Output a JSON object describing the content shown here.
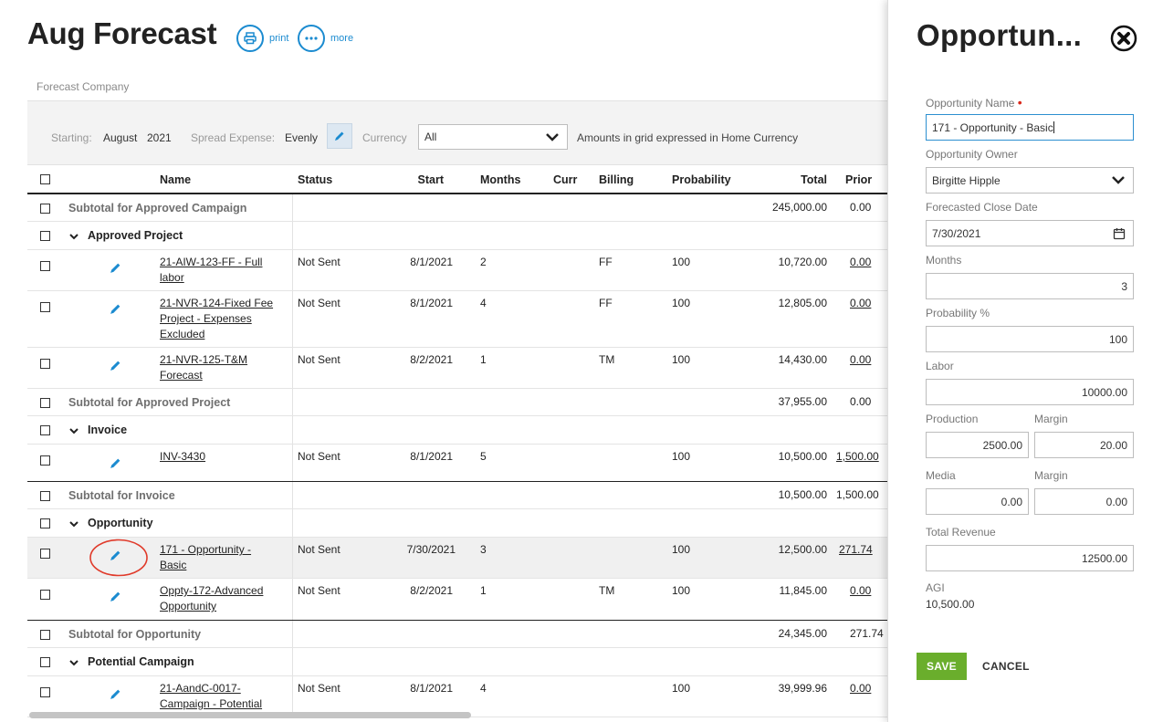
{
  "page": {
    "title": "Aug Forecast",
    "print_label": "print",
    "more_label": "more",
    "company_label": "Forecast Company"
  },
  "filters": {
    "starting_label": "Starting:",
    "starting_month": "August",
    "starting_year": "2021",
    "spread_label": "Spread Expense:",
    "spread_value": "Evenly",
    "currency_label": "Currency",
    "currency_value": "All",
    "note": "Amounts in grid expressed in Home Currency"
  },
  "grid": {
    "columns": {
      "name": "Name",
      "status": "Status",
      "start": "Start",
      "months": "Months",
      "curr": "Curr",
      "billing": "Billing",
      "probability": "Probability",
      "total": "Total",
      "prior": "Prior"
    },
    "rows": {
      "sub_approved_campaign": {
        "label": "Subtotal for Approved Campaign",
        "total": "245,000.00",
        "prior": "0.00"
      },
      "grp_approved_project": {
        "label": "Approved Project"
      },
      "r1": {
        "name": "21-AIW-123-FF - Full labor",
        "status": "Not Sent",
        "start": "8/1/2021",
        "months": "2",
        "billing": "FF",
        "probability": "100",
        "total": "10,720.00",
        "prior": "0.00"
      },
      "r2": {
        "name": "21-NVR-124-Fixed Fee Project - Expenses Excluded",
        "status": "Not Sent",
        "start": "8/1/2021",
        "months": "4",
        "billing": "FF",
        "probability": "100",
        "total": "12,805.00",
        "prior": "0.00"
      },
      "r3": {
        "name": "21-NVR-125-T&M Forecast",
        "status": "Not Sent",
        "start": "8/2/2021",
        "months": "1",
        "billing": "TM",
        "probability": "100",
        "total": "14,430.00",
        "prior": "0.00"
      },
      "sub_approved_project": {
        "label": "Subtotal for Approved Project",
        "total": "37,955.00",
        "prior": "0.00"
      },
      "grp_invoice": {
        "label": "Invoice"
      },
      "r4": {
        "name": "INV-3430",
        "status": "Not Sent",
        "start": "8/1/2021",
        "months": "5",
        "billing": "",
        "probability": "100",
        "total": "10,500.00",
        "prior": "1,500.00"
      },
      "sub_invoice": {
        "label": "Subtotal for Invoice",
        "total": "10,500.00",
        "prior": "1,500.00"
      },
      "grp_opportunity": {
        "label": "Opportunity"
      },
      "r5": {
        "name": "171 - Opportunity - Basic",
        "status": "Not Sent",
        "start": "7/30/2021",
        "months": "3",
        "billing": "",
        "probability": "100",
        "total": "12,500.00",
        "prior": "271.74"
      },
      "r6": {
        "name": "Oppty-172-Advanced Opportunity",
        "status": "Not Sent",
        "start": "8/2/2021",
        "months": "1",
        "billing": "TM",
        "probability": "100",
        "total": "11,845.00",
        "prior": "0.00"
      },
      "sub_opportunity": {
        "label": "Subtotal for Opportunity",
        "total": "24,345.00",
        "prior": "271.74"
      },
      "grp_potential_campaign": {
        "label": "Potential Campaign"
      },
      "r7": {
        "name": "21-AandC-0017-Campaign - Potential",
        "status": "Not Sent",
        "start": "8/1/2021",
        "months": "4",
        "billing": "",
        "probability": "100",
        "total": "39,999.96",
        "prior": "0.00"
      }
    }
  },
  "panel": {
    "title": "Opportun...",
    "opp_name_label": "Opportunity Name",
    "opp_name_value": "171 - Opportunity - Basic",
    "owner_label": "Opportunity Owner",
    "owner_value": "Birgitte Hipple",
    "close_date_label": "Forecasted Close Date",
    "close_date_value": "7/30/2021",
    "months_label": "Months",
    "months_value": "3",
    "probability_label": "Probability %",
    "probability_value": "100",
    "labor_label": "Labor",
    "labor_value": "10000.00",
    "production_label": "Production",
    "production_value": "2500.00",
    "margin_label": "Margin",
    "production_margin_value": "20.00",
    "media_label": "Media",
    "media_value": "0.00",
    "media_margin_value": "0.00",
    "total_revenue_label": "Total Revenue",
    "total_revenue_value": "12500.00",
    "agi_label": "AGI",
    "agi_value": "10,500.00",
    "save_label": "SAVE",
    "cancel_label": "CANCEL"
  },
  "colors": {
    "accent": "#1b8bd0",
    "save": "#6aae2c",
    "required": "#d9281a",
    "highlight_ring": "#e03a2a"
  },
  "icons": [
    "print-icon",
    "more-icon",
    "pencil-icon",
    "chevron-down-icon",
    "calendar-icon",
    "close-icon"
  ]
}
